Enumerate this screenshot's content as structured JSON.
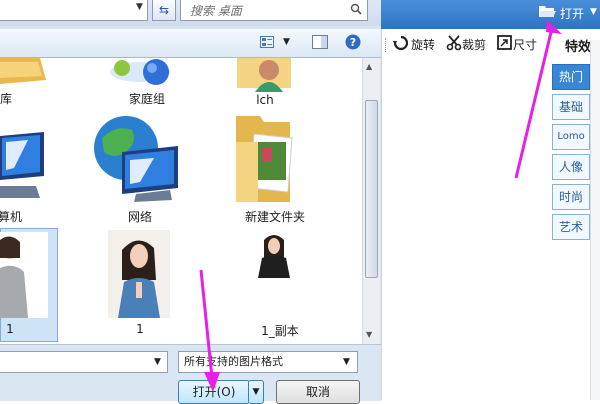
{
  "dialog": {
    "search_placeholder": "搜索 桌面",
    "files": [
      {
        "name": "库",
        "type": "library"
      },
      {
        "name": "家庭组",
        "type": "homegroup"
      },
      {
        "name": "lch",
        "type": "user-folder"
      },
      {
        "name": "算机",
        "type": "computer"
      },
      {
        "name": "网络",
        "type": "network"
      },
      {
        "name": "新建文件夹",
        "type": "folder"
      },
      {
        "name": "1",
        "type": "image"
      },
      {
        "name": "1",
        "type": "image"
      },
      {
        "name": "1_副本",
        "type": "image"
      }
    ],
    "filter_value": "所有支持的图片格式",
    "open_button": "打开(O)",
    "cancel_button": "取消"
  },
  "app": {
    "open_label": "打开",
    "tools": [
      "旋转",
      "裁剪",
      "尺寸"
    ],
    "effects_title": "特效",
    "effect_tabs": [
      "热门",
      "基础",
      "Lomo",
      "人像",
      "时尚",
      "艺术"
    ],
    "active_tab": "热门"
  },
  "colors": {
    "accent": "#3a86d6",
    "annotation_arrow": "#e620e6"
  }
}
